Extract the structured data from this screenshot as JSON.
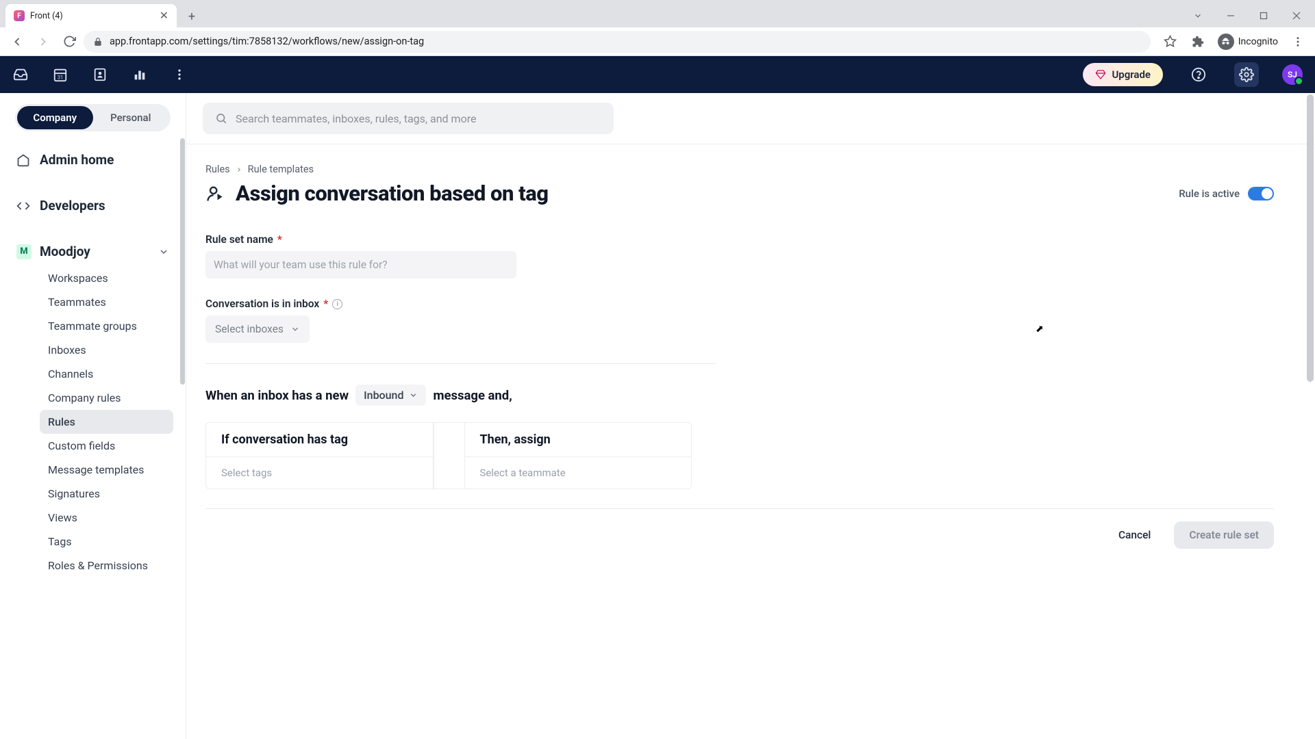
{
  "browser": {
    "tab_title": "Front (4)",
    "url": "app.frontapp.com/settings/tim:7858132/workflows/new/assign-on-tag",
    "incognito_label": "Incognito"
  },
  "header": {
    "upgrade": "Upgrade",
    "avatar_initials": "SJ"
  },
  "sidebar": {
    "seg_company": "Company",
    "seg_personal": "Personal",
    "admin_home": "Admin home",
    "developers": "Developers",
    "group_name": "Moodjoy",
    "group_badge": "M",
    "items": [
      "Workspaces",
      "Teammates",
      "Teammate groups",
      "Inboxes",
      "Channels",
      "Company rules",
      "Rules",
      "Custom fields",
      "Message templates",
      "Signatures",
      "Views",
      "Tags",
      "Roles & Permissions"
    ]
  },
  "search": {
    "placeholder": "Search teammates, inboxes, rules, tags, and more"
  },
  "breadcrumb": {
    "a": "Rules",
    "b": "Rule templates"
  },
  "page": {
    "title": "Assign conversation based on tag",
    "active_label": "Rule is active"
  },
  "form": {
    "ruleset_label": "Rule set name",
    "ruleset_placeholder": "What will your team use this rule for?",
    "inbox_label": "Conversation is in inbox",
    "inbox_select": "Select inboxes",
    "trigger_prefix": "When an inbox has a new",
    "direction": "Inbound",
    "trigger_suffix": "message and,",
    "col_if": "If conversation has tag",
    "col_then": "Then, assign",
    "tags_placeholder": "Select tags",
    "teammate_placeholder": "Select a teammate"
  },
  "footer": {
    "cancel": "Cancel",
    "create": "Create rule set"
  }
}
